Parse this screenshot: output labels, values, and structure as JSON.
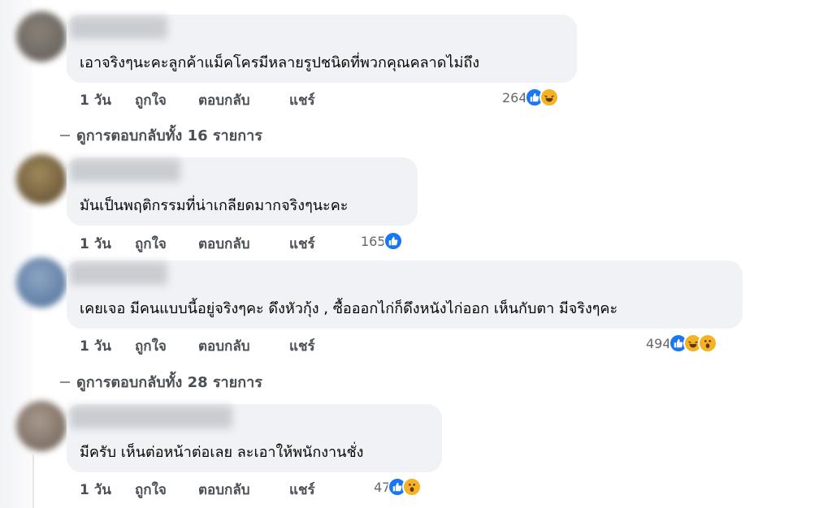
{
  "colors": {
    "bubble": "#f0f2f5",
    "like_blue": "#1877f2",
    "emoji_yellow": "#f7b125",
    "secondary_text": "#65676b"
  },
  "comments": [
    {
      "text": "เอาจริงๆนะคะลูกค้าแม็คโครมีหลายรูปชนิดที่พวกคุณคลาดไม่ถึง",
      "time": "1 วัน",
      "like_label": "ถูกใจ",
      "reply_label": "ตอบกลับ",
      "share_label": "แชร์",
      "reaction_count": "264",
      "reaction_icons": [
        "like-icon",
        "haha-icon"
      ]
    },
    {
      "text": "มันเป็นพฤติกรรมที่น่าเกลียดมากจริงๆนะคะ",
      "time": "1 วัน",
      "like_label": "ถูกใจ",
      "reply_label": "ตอบกลับ",
      "share_label": "แชร์",
      "reaction_count": "165",
      "reaction_icons": [
        "like-icon"
      ]
    },
    {
      "text": "เคยเจอ มีคนแบบนี้อยู่จริงๆคะ ดึงหัวกุ้ง , ซื้อออกไก่ก็ดึงหนังไก่ออก เห็นกับตา มีจริงๆคะ",
      "time": "1 วัน",
      "like_label": "ถูกใจ",
      "reply_label": "ตอบกลับ",
      "share_label": "แชร์",
      "reaction_count": "494",
      "reaction_icons": [
        "like-icon",
        "haha-icon",
        "wow-icon"
      ]
    },
    {
      "text": "มีครับ เห็นต่อหน้าต่อเลย ละเอาให้พนักงานชั่ง",
      "time": "1 วัน",
      "like_label": "ถูกใจ",
      "reply_label": "ตอบกลับ",
      "share_label": "แชร์",
      "reaction_count": "47",
      "reaction_icons": [
        "like-icon",
        "wow-icon"
      ]
    }
  ],
  "view_replies": [
    {
      "label": "ดูการตอบกลับทั้ง 16 รายการ"
    },
    {
      "label": "ดูการตอบกลับทั้ง 28 รายการ"
    }
  ]
}
